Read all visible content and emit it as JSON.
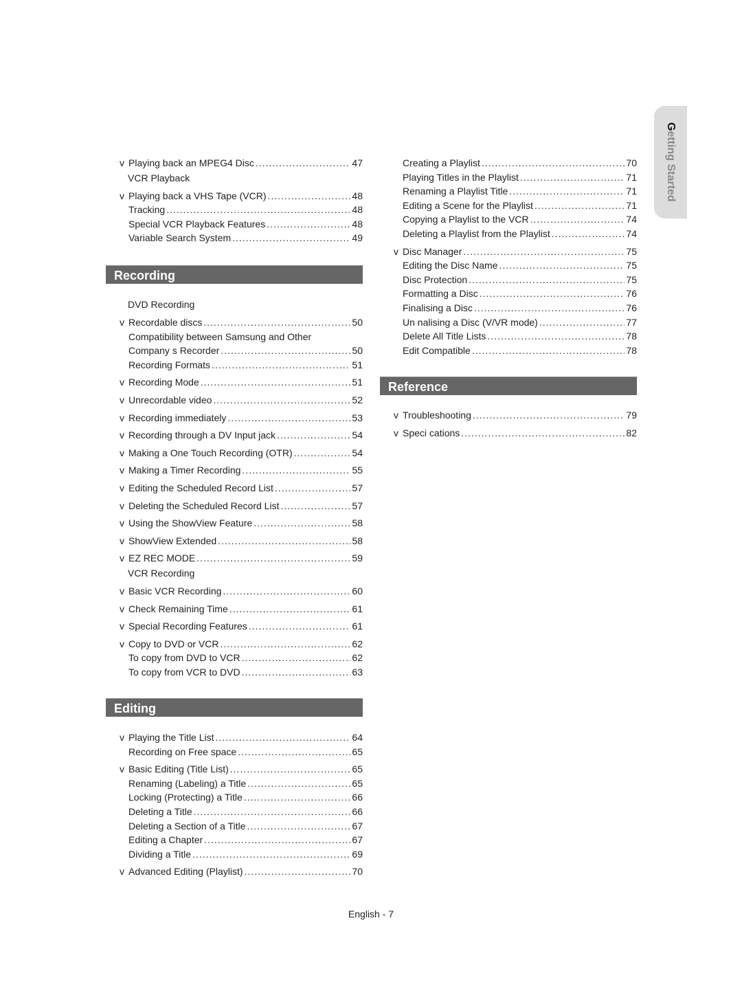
{
  "side_tab": {
    "first_letter": "G",
    "rest": "etting Started"
  },
  "left_column": {
    "top_block": [
      {
        "type": "entry",
        "bullet": "v",
        "title": "Playing back an MPEG4 Disc",
        "page": "47"
      },
      {
        "type": "subhead",
        "title": "VCR Playback"
      },
      {
        "type": "entry",
        "bullet": "v",
        "title": "Playing back a VHS Tape (VCR)",
        "page": "48"
      },
      {
        "type": "entry",
        "bullet": "",
        "title": "Tracking",
        "page": "48",
        "tight": true
      },
      {
        "type": "entry",
        "bullet": "",
        "title": "Special VCR Playback Features",
        "page": "48",
        "tight": true
      },
      {
        "type": "entry",
        "bullet": "",
        "title": "Variable Search System",
        "page": "49",
        "tight": true
      }
    ],
    "recording": {
      "heading": "Recording",
      "items": [
        {
          "type": "subhead",
          "title": "DVD Recording"
        },
        {
          "type": "entry",
          "bullet": "v",
          "title": "Recordable discs",
          "page": "50"
        },
        {
          "type": "text",
          "title": "Compatibility between Samsung and Other"
        },
        {
          "type": "entry",
          "bullet": "",
          "title": "Company s Recorder",
          "page": "50",
          "tight": true
        },
        {
          "type": "entry",
          "bullet": "",
          "title": "Recording Formats",
          "page": "51",
          "tight": true
        },
        {
          "type": "entry",
          "bullet": "v",
          "title": "Recording Mode",
          "page": "51"
        },
        {
          "type": "entry",
          "bullet": "v",
          "title": "Unrecordable video",
          "page": "52"
        },
        {
          "type": "entry",
          "bullet": "v",
          "title": "Recording immediately",
          "page": "53"
        },
        {
          "type": "entry",
          "bullet": "v",
          "title": "Recording through a DV Input jack",
          "page": "54"
        },
        {
          "type": "entry",
          "bullet": "v",
          "title": "Making a One Touch Recording (OTR)",
          "page": "54"
        },
        {
          "type": "entry",
          "bullet": "v",
          "title": "Making a Timer Recording",
          "page": "55"
        },
        {
          "type": "entry",
          "bullet": "v",
          "title": "Editing the Scheduled Record List",
          "page": "57"
        },
        {
          "type": "entry",
          "bullet": "v",
          "title": "Deleting the Scheduled Record List",
          "page": "57"
        },
        {
          "type": "entry",
          "bullet": "v",
          "title": "Using the ShowView Feature",
          "page": "58"
        },
        {
          "type": "entry",
          "bullet": "v",
          "title": "ShowView Extended",
          "page": "58"
        },
        {
          "type": "entry",
          "bullet": "v",
          "title": "EZ REC MODE",
          "page": "59"
        },
        {
          "type": "subhead",
          "title": "VCR Recording"
        },
        {
          "type": "entry",
          "bullet": "v",
          "title": "Basic VCR Recording",
          "page": "60"
        },
        {
          "type": "entry",
          "bullet": "v",
          "title": "Check Remaining Time",
          "page": "61"
        },
        {
          "type": "entry",
          "bullet": "v",
          "title": "Special Recording Features",
          "page": "61"
        },
        {
          "type": "entry",
          "bullet": "v",
          "title": "Copy to DVD or VCR",
          "page": "62"
        },
        {
          "type": "entry",
          "bullet": "",
          "title": "To copy from DVD to VCR",
          "page": "62",
          "tight": true
        },
        {
          "type": "entry",
          "bullet": "",
          "title": "To copy from VCR to DVD",
          "page": "63",
          "tight": true
        }
      ]
    },
    "editing": {
      "heading": "Editing",
      "items": [
        {
          "type": "entry",
          "bullet": "v",
          "title": "Playing the Title List",
          "page": "64"
        },
        {
          "type": "entry",
          "bullet": "",
          "title": "Recording on Free space",
          "page": "65",
          "tight": true
        },
        {
          "type": "entry",
          "bullet": "v",
          "title": "Basic Editing (Title List)",
          "page": "65"
        },
        {
          "type": "entry",
          "bullet": "",
          "title": "Renaming (Labeling) a Title",
          "page": "65",
          "tight": true
        },
        {
          "type": "entry",
          "bullet": "",
          "title": "Locking (Protecting) a Title",
          "page": "66",
          "tight": true
        },
        {
          "type": "entry",
          "bullet": "",
          "title": "Deleting a Title",
          "page": "66",
          "tight": true
        },
        {
          "type": "entry",
          "bullet": "",
          "title": "Deleting a Section of a Title",
          "page": "67",
          "tight": true
        },
        {
          "type": "entry",
          "bullet": "",
          "title": "Editing a Chapter",
          "page": "67",
          "tight": true
        },
        {
          "type": "entry",
          "bullet": "",
          "title": "Dividing a Title",
          "page": "69",
          "tight": true
        },
        {
          "type": "entry",
          "bullet": "v",
          "title": "Advanced Editing (Playlist)",
          "page": "70"
        }
      ]
    }
  },
  "right_column": {
    "top_block": [
      {
        "type": "entry",
        "bullet": "",
        "title": "Creating a Playlist",
        "page": "70",
        "tight": true
      },
      {
        "type": "entry",
        "bullet": "",
        "title": "Playing Titles in the Playlist",
        "page": "71",
        "tight": true
      },
      {
        "type": "entry",
        "bullet": "",
        "title": "Renaming a Playlist Title",
        "page": "71",
        "tight": true
      },
      {
        "type": "entry",
        "bullet": "",
        "title": "Editing a Scene for the Playlist",
        "page": "71",
        "tight": true
      },
      {
        "type": "entry",
        "bullet": "",
        "title": "Copying a Playlist to the VCR",
        "page": "74",
        "tight": true
      },
      {
        "type": "entry",
        "bullet": "",
        "title": "Deleting a Playlist from the Playlist",
        "page": "74",
        "tight": true
      },
      {
        "type": "entry",
        "bullet": "v",
        "title": "Disc Manager",
        "page": "75"
      },
      {
        "type": "entry",
        "bullet": "",
        "title": "Editing the Disc Name",
        "page": "75",
        "tight": true
      },
      {
        "type": "entry",
        "bullet": "",
        "title": "Disc Protection",
        "page": "75",
        "tight": true
      },
      {
        "type": "entry",
        "bullet": "",
        "title": "Formatting a Disc",
        "page": "76",
        "tight": true
      },
      {
        "type": "entry",
        "bullet": "",
        "title": "Finalising a Disc",
        "page": "76",
        "tight": true
      },
      {
        "type": "entry",
        "bullet": "",
        "title": "Un  nalising a Disc (V/VR mode)",
        "page": "77",
        "tight": true
      },
      {
        "type": "entry",
        "bullet": "",
        "title": "Delete All Title Lists",
        "page": "78",
        "tight": true
      },
      {
        "type": "entry",
        "bullet": "",
        "title": "Edit Compatible",
        "page": "78",
        "tight": true
      }
    ],
    "reference": {
      "heading": "Reference",
      "items": [
        {
          "type": "entry",
          "bullet": "v",
          "title": "Troubleshooting",
          "page": "79"
        },
        {
          "type": "entry",
          "bullet": "v",
          "title": "Speci  cations",
          "page": "82"
        }
      ]
    }
  },
  "footer": {
    "page_label": "English - 7"
  }
}
